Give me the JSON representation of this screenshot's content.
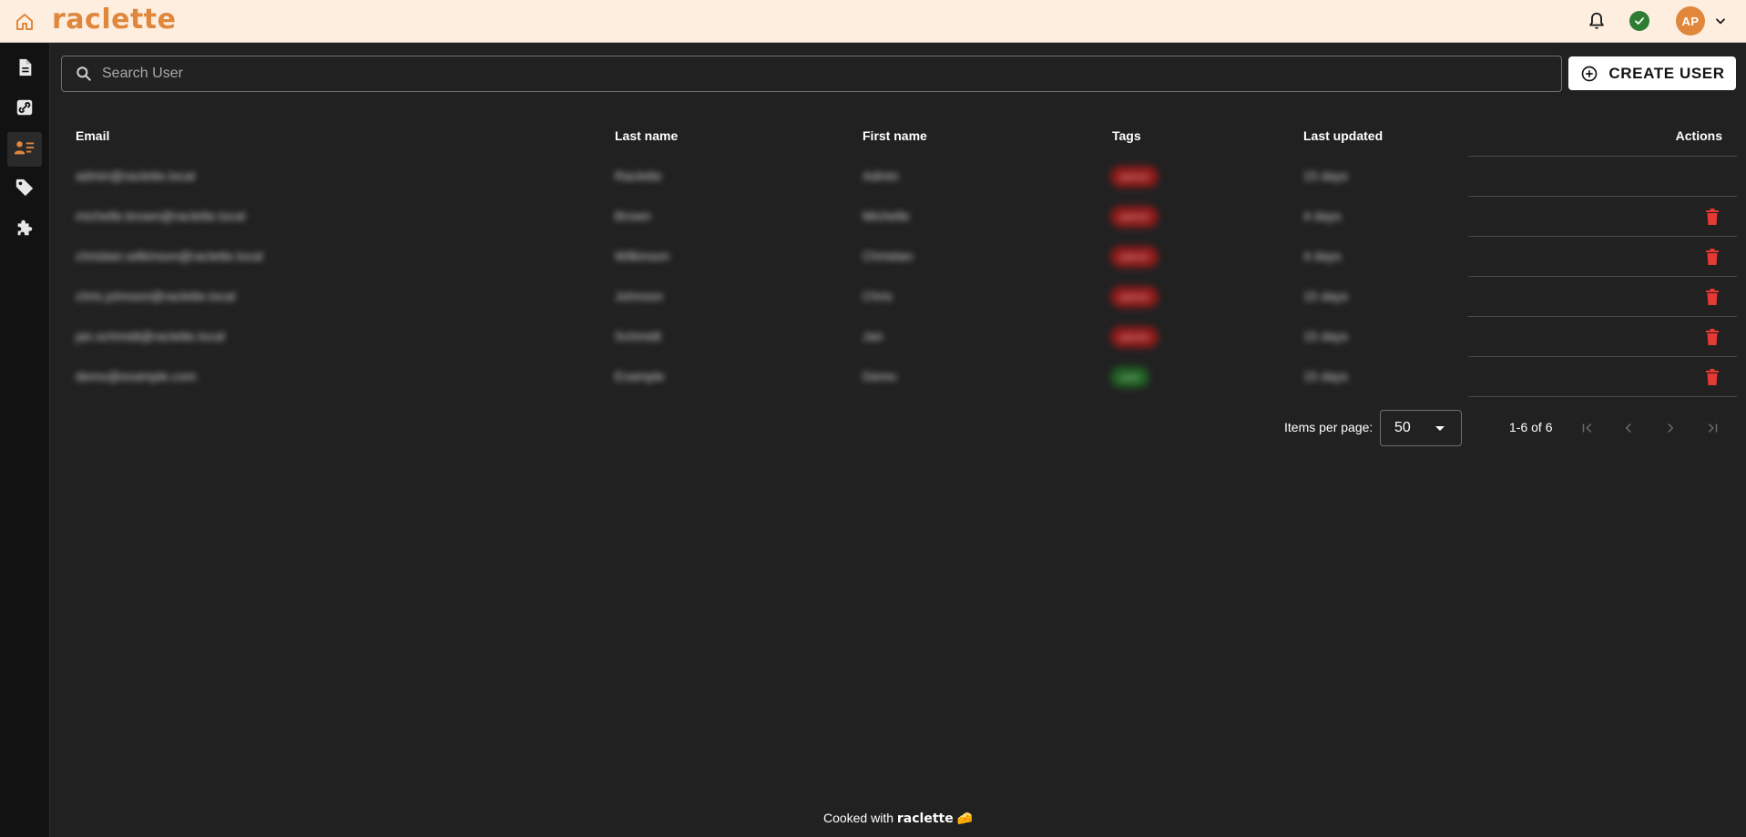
{
  "app": {
    "brand": "raclette",
    "avatar_initials": "AP",
    "accent_color": "#e0873c",
    "topbar_color": "#fdeee0"
  },
  "topbar": {
    "icons": [
      "home-icon",
      "bell-icon",
      "check-circle-icon",
      "chevron-down-icon"
    ]
  },
  "sidebar": {
    "items": [
      {
        "name": "reports",
        "icon": "document-icon",
        "active": false
      },
      {
        "name": "links",
        "icon": "link-icon",
        "active": false
      },
      {
        "name": "users",
        "icon": "user-list-icon",
        "active": true
      },
      {
        "name": "tags",
        "icon": "tag-icon",
        "active": false
      },
      {
        "name": "plugins",
        "icon": "puzzle-icon",
        "active": false
      }
    ]
  },
  "search": {
    "placeholder": "Search User",
    "value": ""
  },
  "create_button": {
    "label": "CREATE USER"
  },
  "table": {
    "columns": [
      "Email",
      "Last name",
      "First name",
      "Tags",
      "Last updated",
      "Actions"
    ],
    "rows": [
      {
        "email": "admin@raclette.local",
        "last_name": "Raclette",
        "first_name": "Admin",
        "tag": "admin",
        "tag_color": "#8a1a1a",
        "updated": "15 days",
        "deletable": false
      },
      {
        "email": "michelle.brown@raclette.local",
        "last_name": "Brown",
        "first_name": "Michelle",
        "tag": "admin",
        "tag_color": "#8a1a1a",
        "updated": "4 days",
        "deletable": true
      },
      {
        "email": "christian.wilkinson@raclette.local",
        "last_name": "Wilkinson",
        "first_name": "Christian",
        "tag": "admin",
        "tag_color": "#8a1a1a",
        "updated": "4 days",
        "deletable": true
      },
      {
        "email": "chris.johnson@raclette.local",
        "last_name": "Johnson",
        "first_name": "Chris",
        "tag": "admin",
        "tag_color": "#8a1a1a",
        "updated": "15 days",
        "deletable": true
      },
      {
        "email": "jan.schmidt@raclette.local",
        "last_name": "Schmidt",
        "first_name": "Jan",
        "tag": "admin",
        "tag_color": "#8a1a1a",
        "updated": "15 days",
        "deletable": true
      },
      {
        "email": "demo@example.com",
        "last_name": "Example",
        "first_name": "Demo",
        "tag": "user",
        "tag_color": "#1f5a22",
        "updated": "15 days",
        "deletable": true
      }
    ]
  },
  "pagination": {
    "items_per_page_label": "Items per page:",
    "items_per_page": "50",
    "range": "1-6 of 6"
  },
  "footer": {
    "prefix": "Cooked with",
    "brand": "raclette",
    "emoji": "🧀"
  }
}
